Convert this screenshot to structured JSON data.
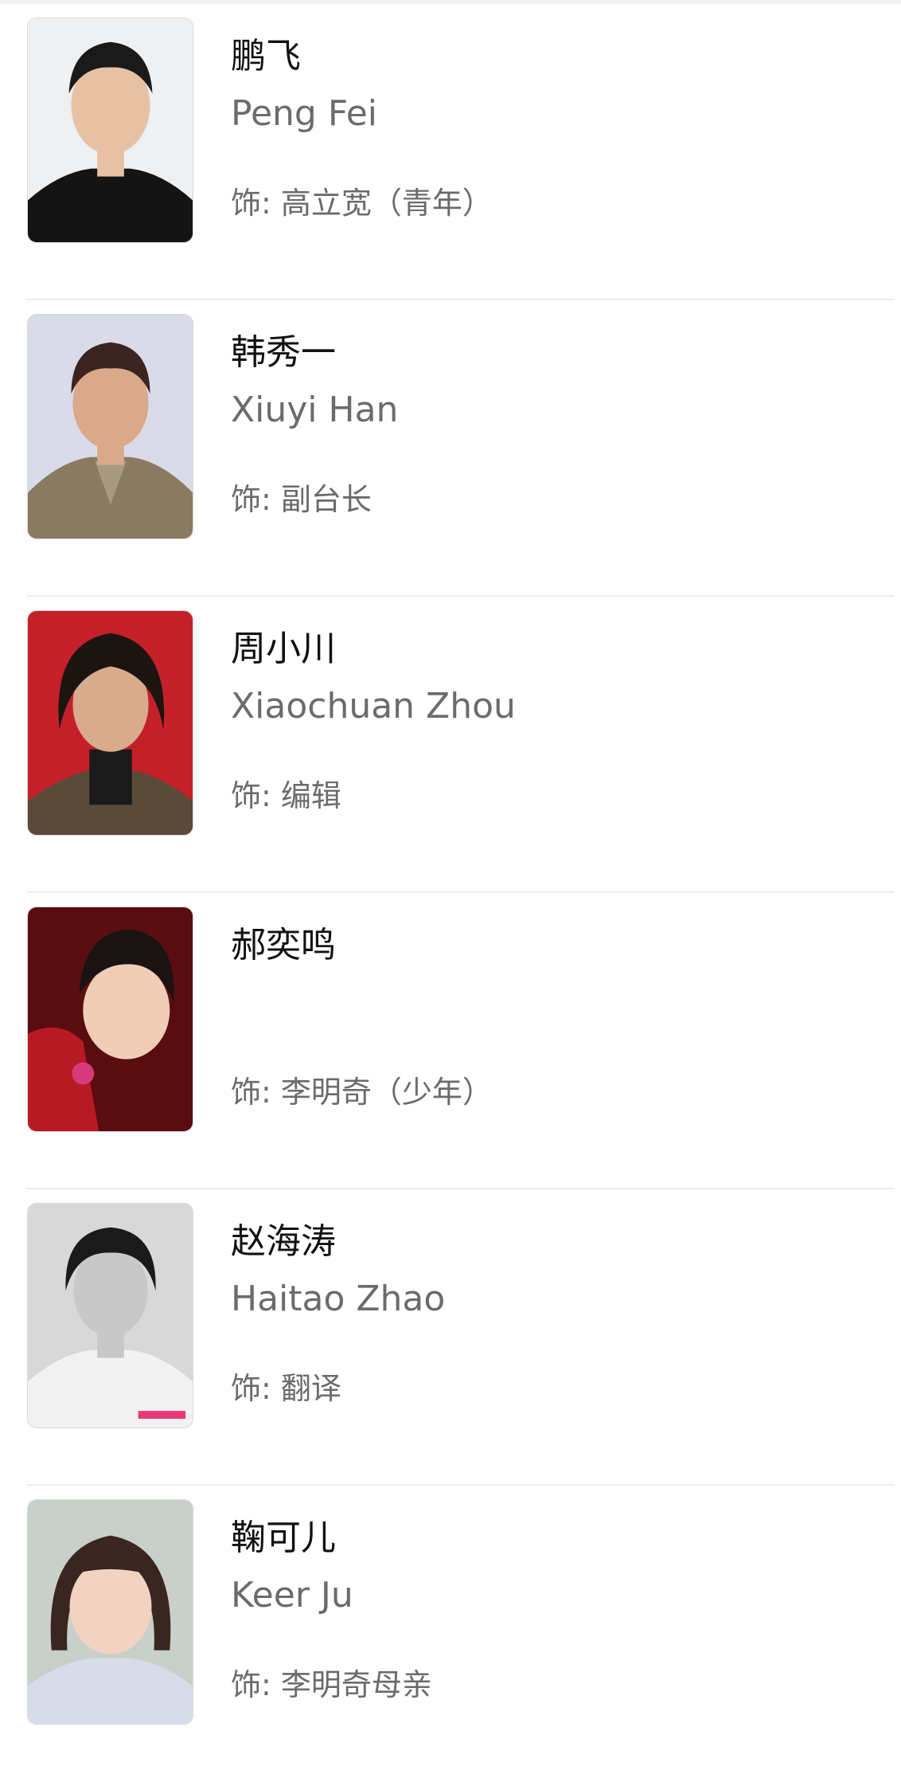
{
  "cast": [
    {
      "name_cn": "鹏飞",
      "name_en": "Peng Fei",
      "role_prefix": "饰: ",
      "role": "高立宽（青年）",
      "bg": "#eef0f2",
      "hair": "#1a1a1a",
      "skin": "#e6c1a4",
      "cloth": "#141414"
    },
    {
      "name_cn": "韩秀一",
      "name_en": "Xiuyi Han",
      "role_prefix": "饰: ",
      "role": "副台长",
      "bg": "#d9dbe8",
      "hair": "#3b2420",
      "skin": "#d9a98a",
      "cloth": "#8a7a62"
    },
    {
      "name_cn": "周小川",
      "name_en": "Xiaochuan Zhou",
      "role_prefix": "饰: ",
      "role": "编辑",
      "bg": "#c4202a",
      "hair": "#1c1410",
      "skin": "#d8ab8c",
      "cloth": "#1a1a1a"
    },
    {
      "name_cn": "郝奕鸣",
      "name_en": "",
      "role_prefix": "饰: ",
      "role": "李明奇（少年）",
      "bg": "#5a0d10",
      "hair": "#1b1212",
      "skin": "#f0cdb6",
      "cloth": "#b81a24"
    },
    {
      "name_cn": "赵海涛",
      "name_en": "Haitao Zhao",
      "role_prefix": "饰: ",
      "role": "翻译",
      "bg": "#d8d8d8",
      "hair": "#1a1a1a",
      "skin": "#c8c8c8",
      "cloth": "#f2f2f2"
    },
    {
      "name_cn": "鞠可儿",
      "name_en": "Keer Ju",
      "role_prefix": "饰: ",
      "role": "李明奇母亲",
      "bg": "#c9cfc9",
      "hair": "#3a2620",
      "skin": "#f2d2c0",
      "cloth": "#d6dce8"
    }
  ]
}
